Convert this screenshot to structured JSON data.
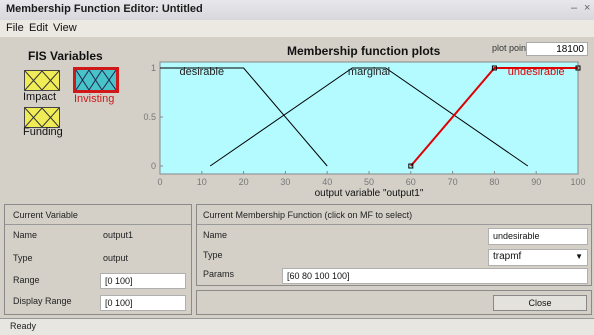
{
  "window": {
    "title": "Membership Function Editor: Untitled",
    "minimize": "–",
    "close": "×"
  },
  "menu": [
    "File",
    "Edit",
    "View"
  ],
  "fis": {
    "title": "FIS Variables",
    "variables": [
      {
        "label": "Impact",
        "selected": false
      },
      {
        "label": "Invisting",
        "selected": true
      },
      {
        "label": "Funding",
        "selected": false
      }
    ]
  },
  "plot": {
    "title": "Membership function plots",
    "points_label": "plot points:",
    "points_value": "18100",
    "xlabel": "output variable \"output1\""
  },
  "chart_data": {
    "type": "line",
    "title": "Membership function plots",
    "xlabel": "output variable \"output1\"",
    "xlim": [
      0,
      100
    ],
    "ylim": [
      0,
      1
    ],
    "xticks": [
      "0",
      "10",
      "20",
      "30",
      "40",
      "50",
      "60",
      "70",
      "80",
      "90",
      "100"
    ],
    "yticks": [
      "0",
      "0.5",
      "1"
    ],
    "series": [
      {
        "name": "desirable",
        "color": "#000000",
        "x": [
          0,
          20,
          40
        ],
        "y": [
          1,
          1,
          0
        ]
      },
      {
        "name": "marginal",
        "color": "#000000",
        "x": [
          12,
          46,
          54,
          88
        ],
        "y": [
          0,
          1,
          1,
          0
        ]
      },
      {
        "name": "undesirable",
        "color": "#e00000",
        "x": [
          60,
          80,
          100,
          100
        ],
        "y": [
          0,
          1,
          1,
          1
        ]
      }
    ],
    "highlighted": "undesirable",
    "background": "#b3fbff"
  },
  "current_variable": {
    "header": "Current Variable",
    "name_label": "Name",
    "name_value": "output1",
    "type_label": "Type",
    "type_value": "output",
    "range_label": "Range",
    "range_value": "[0 100]",
    "display_range_label": "Display Range",
    "display_range_value": "[0 100]"
  },
  "current_mf": {
    "header": "Current Membership Function (click on MF to select)",
    "name_label": "Name",
    "name_value": "undesirable",
    "type_label": "Type",
    "type_value": "trapmf",
    "params_label": "Params",
    "params_value": "[60 80 100 100]",
    "close_label": "Close"
  },
  "status": "Ready"
}
